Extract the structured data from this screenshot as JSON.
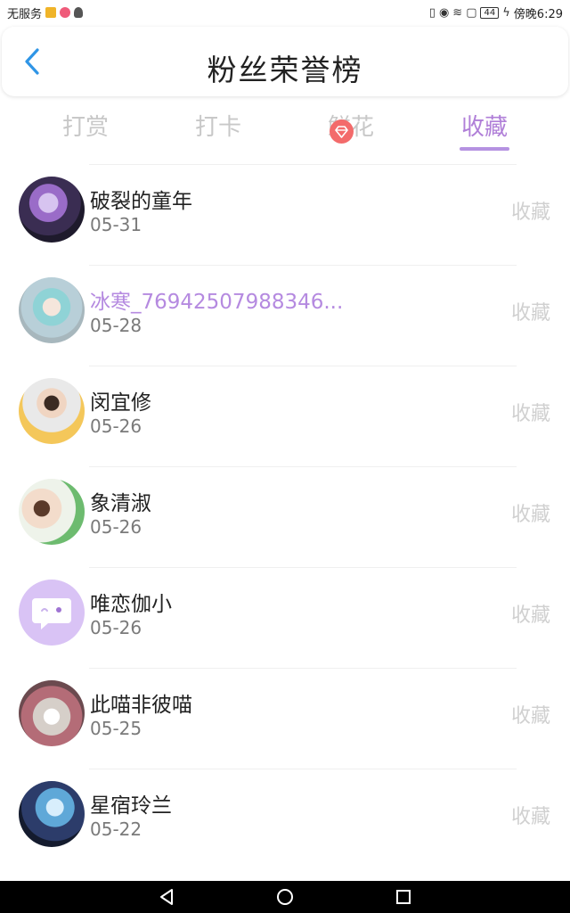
{
  "status_bar": {
    "carrier": "无服务",
    "battery": "44",
    "time": "傍晚6:29"
  },
  "header": {
    "title": "粉丝荣誉榜"
  },
  "tabs": [
    {
      "label": "打赏",
      "active": false
    },
    {
      "label": "打卡",
      "active": false
    },
    {
      "label": "鲜花",
      "active": false
    },
    {
      "label": "收藏",
      "active": true
    }
  ],
  "list": [
    {
      "name": "破裂的童年",
      "date": "05-31",
      "type": "收藏"
    },
    {
      "name": "冰寒_76942507988346...",
      "date": "05-28",
      "type": "收藏",
      "vip": true
    },
    {
      "name": "闵宜修",
      "date": "05-26",
      "type": "收藏"
    },
    {
      "name": "象清淑",
      "date": "05-26",
      "type": "收藏"
    },
    {
      "name": "唯恋伽小",
      "date": "05-26",
      "type": "收藏"
    },
    {
      "name": "此喵非彼喵",
      "date": "05-25",
      "type": "收藏"
    },
    {
      "name": "星宿玲兰",
      "date": "05-22",
      "type": "收藏"
    }
  ],
  "colors": {
    "accent": "#b07fd8",
    "inactive_tab": "#c8c8c8",
    "back_arrow": "#2f95e6",
    "vip_badge": "#f36b6b"
  }
}
